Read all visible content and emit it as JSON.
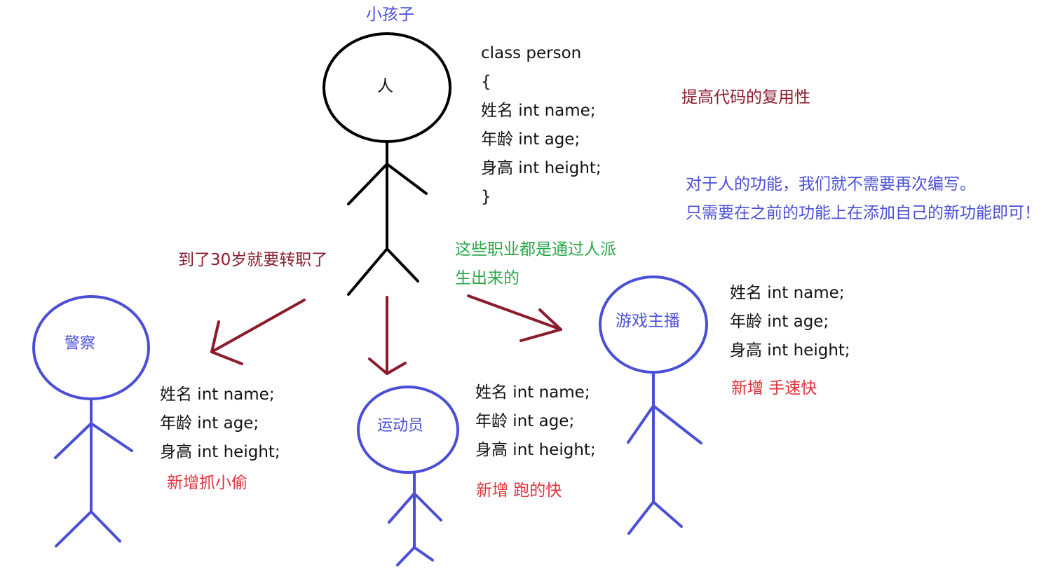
{
  "figures": {
    "person": {
      "label": "人",
      "caption": "小孩子",
      "color": "#000000"
    },
    "police": {
      "label": "警察",
      "color": "#4a4fd6"
    },
    "athlete": {
      "label": "运动员",
      "color": "#4a4fd6"
    },
    "streamer": {
      "label": "游戏主播",
      "color": "#4a4fd6"
    }
  },
  "base_class": {
    "lines": [
      "class  person",
      "{",
      "姓名  int name;",
      "年龄  int age;",
      "身高 int  height;",
      "}"
    ]
  },
  "fields": [
    "姓名  int name;",
    "年龄  int age;",
    "身高 int  height;"
  ],
  "additions": {
    "police": "新增抓小偷",
    "athlete": "新增 跑的快",
    "streamer": "新增  手速快"
  },
  "notes": {
    "reuse": "提高代码的复用性",
    "no_rewrite_1": "对于人的功能，我们就不需要再次编写。",
    "no_rewrite_2": "只需要在之前的功能上在添加自己的新功能即可！",
    "transfer": "到了30岁就要转职了",
    "derived_1": "这些职业都是通过人派",
    "derived_2": "生出来的"
  },
  "colors": {
    "blue": "#4a4fd6",
    "maroon": "#8b1a2b",
    "green": "#29a84a",
    "red": "#e0323a",
    "black": "#000000"
  }
}
